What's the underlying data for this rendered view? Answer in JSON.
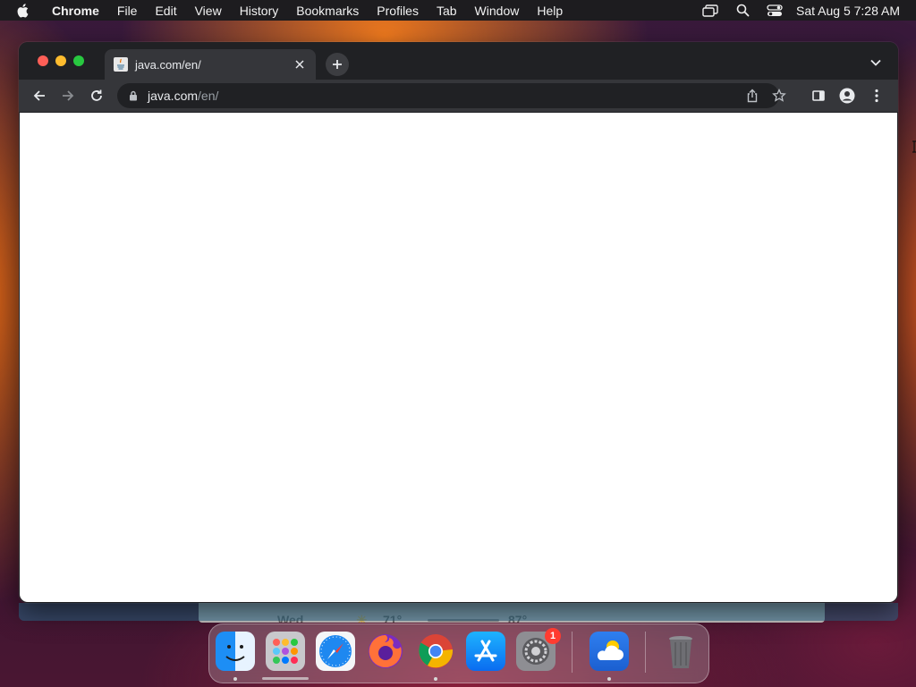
{
  "menubar": {
    "app_name": "Chrome",
    "items": [
      "File",
      "Edit",
      "View",
      "History",
      "Bookmarks",
      "Profiles",
      "Tab",
      "Window",
      "Help"
    ],
    "clock": "Sat Aug 5  7:28 AM"
  },
  "browser": {
    "tab": {
      "title": "java.com/en/"
    },
    "address": {
      "host": "java.com",
      "path": "/en/"
    }
  },
  "widget": {
    "day": "Wed",
    "low": "71°",
    "high": "87°"
  },
  "dock": {
    "apps": [
      "Finder",
      "Launchpad",
      "Safari",
      "Firefox",
      "Google Chrome",
      "App Store",
      "System Settings",
      "Weather",
      "Trash"
    ],
    "settings_badge": "1"
  },
  "colors": {
    "menubar_bg": "#1d1c1f",
    "tabstrip_bg": "#202124",
    "toolbar_bg": "#35363a",
    "content_bg": "#ffffff"
  }
}
